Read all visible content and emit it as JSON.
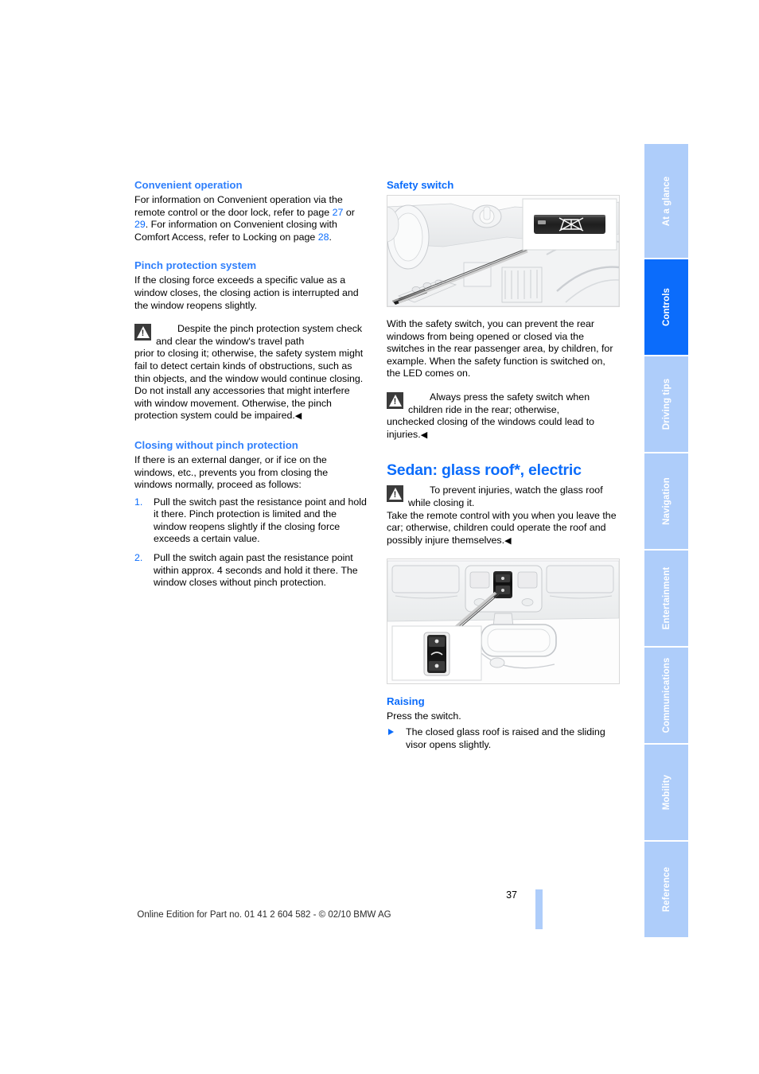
{
  "document": {
    "page_number": "37",
    "footer_text": "Online Edition for Part no. 01 41 2 604 582 - © 02/10 BMW AG"
  },
  "sidebar": {
    "tabs": [
      {
        "label": "At a glance",
        "active": false
      },
      {
        "label": "Controls",
        "active": true
      },
      {
        "label": "Driving tips",
        "active": false
      },
      {
        "label": "Navigation",
        "active": false
      },
      {
        "label": "Entertainment",
        "active": false
      },
      {
        "label": "Communications",
        "active": false
      },
      {
        "label": "Mobility",
        "active": false
      },
      {
        "label": "Reference",
        "active": false
      }
    ]
  },
  "left_column": {
    "convenient_operation": {
      "heading": "Convenient operation",
      "paragraph_1": "For information on Convenient operation via the remote control or the door lock, refer to page ",
      "page_ref_1": "27",
      "paragraph_2": " or ",
      "page_ref_2": "29",
      "paragraph_3": ". For information on Convenient closing with Comfort Access, refer to Locking on page ",
      "page_ref_3": "28",
      "paragraph_4": "."
    },
    "pinch_protection": {
      "heading": "Pinch protection system",
      "intro": "If the closing force exceeds a specific value as a window closes, the closing action is interrupted and the window reopens slightly.",
      "warning_lead": "Despite the pinch protection system check and clear the window's travel path",
      "warning_rest": "prior to closing it; otherwise, the safety system might fail to detect certain kinds of obstructions, such as thin objects, and the window would continue closing.",
      "warning_rest_2": "Do not install any accessories that might interfere with window movement. Otherwise, the pinch protection system could be impaired.",
      "end_mark": "◀"
    },
    "closing_without": {
      "heading": "Closing without pinch protection",
      "intro": "If there is an external danger, or if ice on the windows, etc., prevents you from closing the windows normally, proceed as follows:",
      "steps": [
        {
          "num": "1.",
          "text": "Pull the switch past the resistance point and hold it there. Pinch protection is limited and the window reopens slightly if the closing force exceeds a certain value."
        },
        {
          "num": "2.",
          "text": "Pull the switch again past the resistance point within approx. 4 seconds and hold it there. The window closes without pinch protection."
        }
      ]
    }
  },
  "right_column": {
    "safety_switch": {
      "heading": "Safety switch",
      "figure_name": "safety-switch-illustration",
      "paragraph": "With the safety switch, you can prevent the rear windows from being opened or closed via the switches in the rear passenger area, by children, for example. When the safety function is switched on, the LED comes on.",
      "warning_lead": "Always press the safety switch when children ride in the rear; otherwise,",
      "warning_rest": "unchecked closing of the windows could lead to injuries.",
      "end_mark": "◀"
    },
    "glass_roof": {
      "heading": "Sedan: glass roof*, electric",
      "warning_lead": "To prevent injuries, watch the glass roof while closing it.",
      "warning_rest": "Take the remote control with you when you leave the car; otherwise, children could operate the roof and possibly injure themselves.",
      "end_mark": "◀",
      "figure_name": "glass-roof-switch-illustration"
    },
    "raising": {
      "heading": "Raising",
      "instruction": "Press the switch.",
      "results": [
        {
          "text": "The closed glass roof is raised and the sliding visor opens slightly."
        }
      ]
    }
  },
  "colors": {
    "accent_blue": "#0b6cfb",
    "heading_blue": "#2f7ffb",
    "tab_inactive": "#aecdfa",
    "tab_active": "#0b6cfb"
  }
}
